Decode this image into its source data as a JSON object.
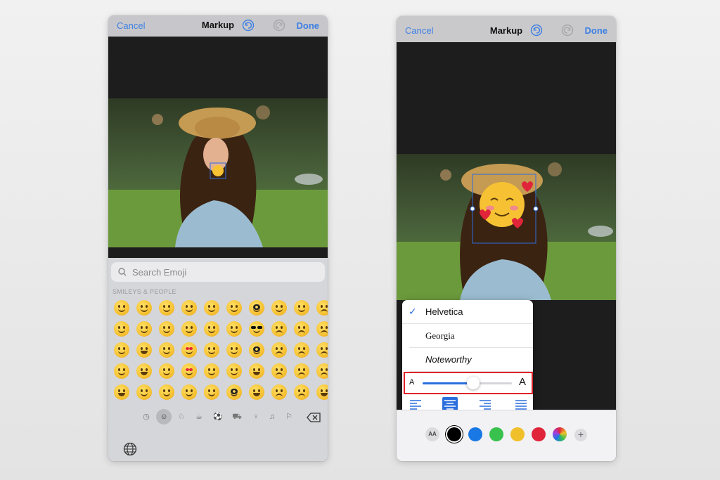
{
  "left": {
    "nav": {
      "cancel": "Cancel",
      "title": "Markup",
      "done": "Done"
    },
    "search": {
      "placeholder": "Search Emoji"
    },
    "section_label": "SMILEYS & PEOPLE",
    "emoji_rows": [
      [
        "grin",
        "pleading",
        "relaxed",
        "wink",
        "kiss",
        "tongue",
        "nerd",
        "smirk",
        "neutral",
        "tired"
      ],
      [
        "smiley",
        "sweat",
        "blush",
        "relieved",
        "kiss-smile",
        "zany",
        "cool",
        "unamused",
        "frown",
        "weary"
      ],
      [
        "grinning",
        "joy",
        "halo",
        "heart-eyes",
        "kiss-closed",
        "crazy",
        "disguise",
        "pensive",
        "sad",
        "anxious"
      ],
      [
        "beam",
        "rofl",
        "slight",
        "smiling-hearts",
        "smile-kiss",
        "raised-brow",
        "star-struck",
        "worried",
        "confounded",
        "cry"
      ],
      [
        "laugh",
        "flushed",
        "upside",
        "blow-kiss",
        "sweet",
        "monocle",
        "party",
        "persevere",
        "disappointed",
        "scream"
      ]
    ],
    "categories": [
      "recent-icon",
      "smileys-icon",
      "animals-icon",
      "food-icon",
      "activity-icon",
      "travel-icon",
      "objects-icon",
      "symbols-icon",
      "flags-icon"
    ]
  },
  "right": {
    "nav": {
      "cancel": "Cancel",
      "title": "Markup",
      "done": "Done"
    },
    "fonts": [
      {
        "label": "Helvetica",
        "selected": true
      },
      {
        "label": "Georgia",
        "selected": false
      },
      {
        "label": "Noteworthy",
        "selected": false
      }
    ],
    "size": {
      "small": "A",
      "large": "A",
      "value": 0.57
    },
    "alignment": [
      "left",
      "center",
      "right",
      "justified"
    ],
    "selected_alignment": "center",
    "toolbar": {
      "aa": "AA",
      "colors": [
        "#000000",
        "#1a78e5",
        "#38c14c",
        "#f0c02a",
        "#e0243a"
      ],
      "plus": "+"
    }
  }
}
